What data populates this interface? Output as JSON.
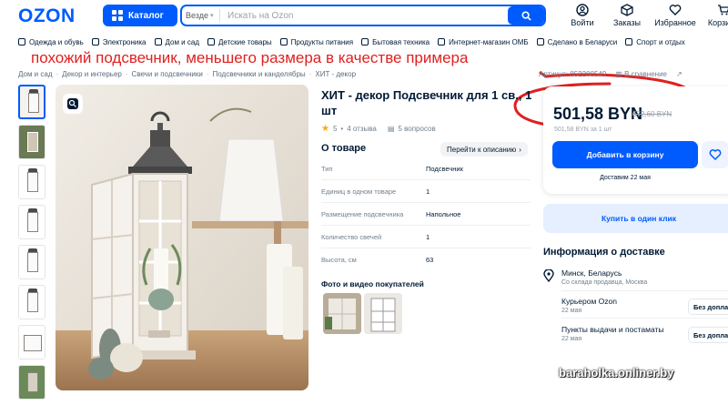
{
  "header": {
    "logo": "OZON",
    "catalog_label": "Каталог",
    "search_scope": "Везде",
    "search_placeholder": "Искать на Ozon",
    "icons": [
      {
        "label": "Войти",
        "icon": "user-icon"
      },
      {
        "label": "Заказы",
        "icon": "box-icon"
      },
      {
        "label": "Избранное",
        "icon": "heart-icon"
      },
      {
        "label": "Корзина",
        "icon": "cart-icon"
      }
    ]
  },
  "categories": [
    "Одежда и обувь",
    "Электроника",
    "Дом и сад",
    "Детские товары",
    "Продукты питания",
    "Бытовая техника",
    "Интернет-магазин ОМБ",
    "Сделано в Беларуси",
    "Спорт и отдых"
  ],
  "annotation": {
    "text": "похожий подсвечник, меньшего размера в качестве примера",
    "color": "#e02020"
  },
  "breadcrumbs": [
    "Дом и сад",
    "Декор и интерьер",
    "Свечи и подсвечники",
    "Подсвечники и канделябры",
    "ХИТ - декор"
  ],
  "article": {
    "label": "Артикул: 852200549",
    "compare": "В сравнение"
  },
  "product": {
    "title": "ХИТ - декор Подсвечник для 1 св., 1 шт",
    "rating": "5",
    "reviews": "4 отзыва",
    "questions": "5 вопросов",
    "about_heading": "О товаре",
    "about_link": "Перейти к описанию",
    "specs": [
      {
        "key": "Тип",
        "value": "Подсвечник"
      },
      {
        "key": "Единиц в одном товаре",
        "value": "1"
      },
      {
        "key": "Размещение подсвечника",
        "value": "Напольное"
      },
      {
        "key": "Количество свечей",
        "value": "1"
      },
      {
        "key": "Высота, см",
        "value": "63"
      }
    ],
    "photos_heading": "Фото и видео покупателей"
  },
  "purchase": {
    "price": "501,58 BYN",
    "old_price": "672,60 BYN",
    "per_unit": "501,58 BYN за 1 шт",
    "cart_label": "Добавить в корзину",
    "delivery_date": "Доставим 22 мая",
    "one_click_label": "Купить в один клик"
  },
  "delivery": {
    "heading": "Информация о доставке",
    "city": "Минск, Беларусь",
    "city_sub": "Со склада продавца, Москва",
    "options": [
      {
        "title": "Курьером Ozon",
        "date": "22 мая",
        "badge": "Без доплаты"
      },
      {
        "title": "Пункты выдачи и постаматы",
        "date": "22 мая",
        "badge": "Без доплаты"
      }
    ]
  },
  "watermark": "baraholka.onliner.by",
  "colors": {
    "brand": "#005bff",
    "annotation": "#e02020"
  }
}
